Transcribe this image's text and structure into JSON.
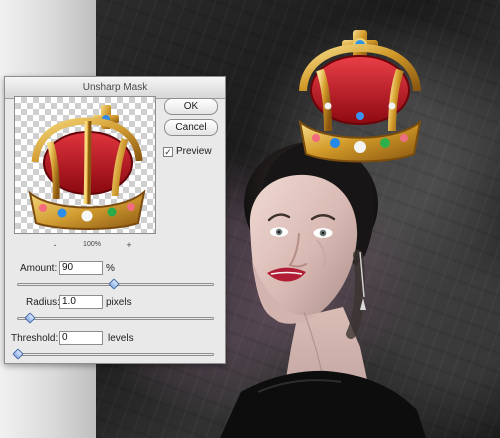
{
  "dialog": {
    "title": "Unsharp Mask",
    "buttons": {
      "ok": "OK",
      "cancel": "Cancel"
    },
    "preview": {
      "label": "Preview",
      "checked": "✓",
      "zoom_minus": "-",
      "zoom_value": "100%",
      "zoom_plus": "+"
    },
    "controls": {
      "amount": {
        "label": "Amount:",
        "value": "90",
        "unit": "%",
        "slider_fraction": 0.49
      },
      "radius": {
        "label": "Radius:",
        "value": "1.0",
        "unit": "pixels",
        "slider_fraction": 0.06
      },
      "threshold": {
        "label": "Threshold:",
        "value": "0",
        "unit": "levels",
        "slider_fraction": 0.0
      }
    }
  },
  "icons": {
    "preview_crown": "crown-preview-icon",
    "main_crown": "crown-photo-icon",
    "portrait": "portrait-photo"
  },
  "colors": {
    "dialog_bg": "#e9e9e9",
    "canvas_dark": "#1f1f1f",
    "slider_thumb": "#8eb1e8",
    "crown_red": "#b3121b",
    "crown_gold": "#d7a53c"
  }
}
